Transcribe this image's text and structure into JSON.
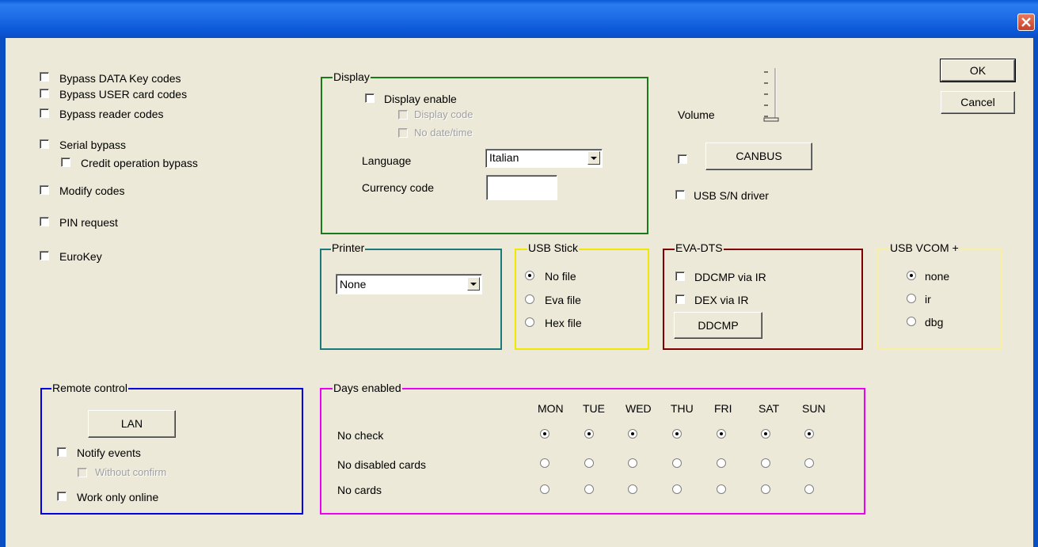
{
  "window": {
    "title": "",
    "close_icon": "close-x-icon"
  },
  "buttons": {
    "ok": "OK",
    "cancel": "Cancel",
    "canbus": "CANBUS",
    "ddcmp": "DDCMP",
    "lan": "LAN"
  },
  "left_options": {
    "bypass_data_key": "Bypass DATA Key codes",
    "bypass_user_card": "Bypass USER card codes",
    "bypass_reader": "Bypass reader codes",
    "serial_bypass": "Serial bypass",
    "credit_operation_bypass": "Credit operation bypass",
    "modify_codes": "Modify codes",
    "pin_request": "PIN request",
    "eurokey": "EuroKey"
  },
  "display": {
    "group_label": "Display",
    "display_enable": "Display enable",
    "display_code": "Display code",
    "no_date_time": "No date/time",
    "language_label": "Language",
    "language_value": "Italian",
    "currency_label": "Currency code",
    "currency_value": ""
  },
  "volume": {
    "label": "Volume"
  },
  "usb_sn_driver": "USB S/N driver",
  "printer": {
    "group_label": "Printer",
    "value": "None"
  },
  "usb_stick": {
    "group_label": "USB Stick",
    "options": [
      "No file",
      "Eva file",
      "Hex file"
    ],
    "selected": "No file"
  },
  "eva_dts": {
    "group_label": "EVA-DTS",
    "ddcmp_via_ir": "DDCMP via IR",
    "dex_via_ir": "DEX via IR"
  },
  "usb_vcom": {
    "group_label": "USB VCOM +",
    "options": [
      "none",
      "ir",
      "dbg"
    ],
    "selected": "none"
  },
  "remote_control": {
    "group_label": "Remote control",
    "notify_events": "Notify events",
    "without_confirm": "Without confirm",
    "work_only_online": "Work only online"
  },
  "days_enabled": {
    "group_label": "Days enabled",
    "days": [
      "MON",
      "TUE",
      "WED",
      "THU",
      "FRI",
      "SAT",
      "SUN"
    ],
    "rows": [
      "No check",
      "No disabled cards",
      "No cards"
    ],
    "selected_row": "No check"
  },
  "colors": {
    "display_group": "#1a7a1a",
    "printer_group": "#1a7a7a",
    "usb_stick_group": "#f0e800",
    "eva_dts_group": "#800000",
    "usb_vcom_group": "#f8f0a0",
    "remote_control_group": "#0000e0",
    "days_enabled_group": "#f000f0"
  }
}
